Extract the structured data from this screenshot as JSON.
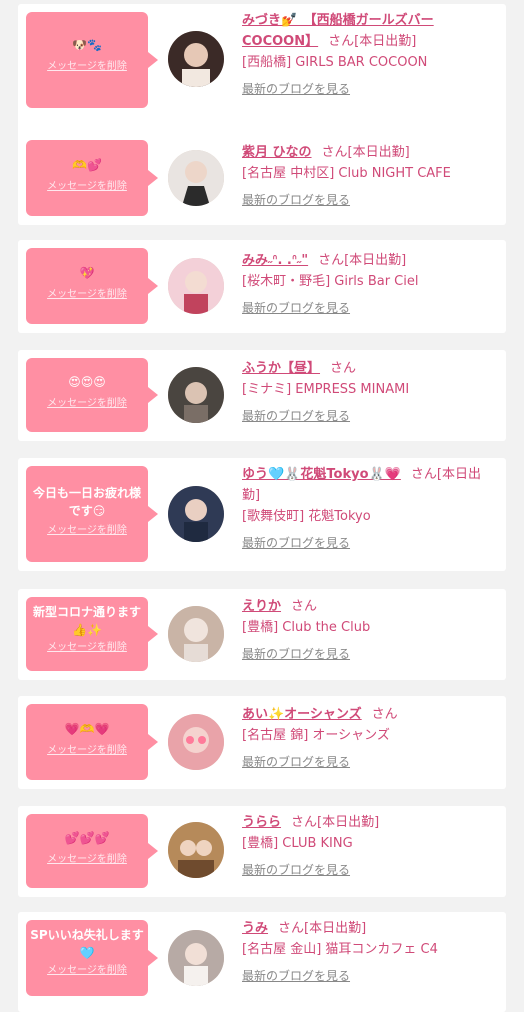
{
  "theme": {
    "accent": "#ff8fa3",
    "name_color": "#d04a78",
    "background": "#f2f2f2"
  },
  "labels": {
    "delete": "メッセージを削除",
    "blog": "最新のブログを見る",
    "san": "さん",
    "on_duty": "[本日出勤]"
  },
  "cards": [
    {
      "message": "🐶🐾",
      "name": "みづき💅　【西船橋ガールズバーCOCOON】",
      "suffix": "さん[本日出勤]",
      "shop": "[西船橋] GIRLS BAR COCOON",
      "avatar_color": "#3b2a27"
    },
    {
      "message": "🫶💕",
      "name": "紫月 ひなの",
      "suffix": "さん[本日出勤]",
      "shop": "[名古屋 中村区] Club NIGHT CAFE",
      "avatar_color": "#d8d3cf"
    },
    {
      "message": "💖",
      "name": "みみ˶ᐢ. .ᐢ˶\"",
      "suffix": "さん[本日出勤]",
      "shop": "[桜木町・野毛] Girls Bar Ciel",
      "avatar_color": "#e8b6c2"
    },
    {
      "message": "😍😍😍",
      "name": "ふうか【昼】",
      "suffix": "さん",
      "shop": "[ミナミ] EMPRESS MINAMI",
      "avatar_color": "#4a4540"
    },
    {
      "message": "今日も一日お疲れ様です😏",
      "name": "ゆう🩵🐰花魁Tokyo🐰💗",
      "suffix": "さん[本日出勤]",
      "shop": "[歌舞伎町] 花魁Tokyo",
      "avatar_color": "#2f3a55"
    },
    {
      "message": "新型コロナ通ります👍✨",
      "name": "えりか",
      "suffix": "さん",
      "shop": "[豊橋] Club the Club",
      "avatar_color": "#c9b4a6"
    },
    {
      "message": "💗🫶💗",
      "name": "あい✨オーシャンズ",
      "suffix": "さん",
      "shop": "[名古屋 錦] オーシャンズ",
      "avatar_color": "#e9a3a9"
    },
    {
      "message": "💕💕💕",
      "name": "うらら",
      "suffix": "さん[本日出勤]",
      "shop": "[豊橋] CLUB KING",
      "avatar_color": "#b68a5a"
    },
    {
      "message": "SPいいね失礼します🩵",
      "name": "うみ",
      "suffix": "さん[本日出勤]",
      "shop": "[名古屋 金山] 猫耳コンカフェ C4",
      "avatar_color": "#b7aaa5"
    }
  ]
}
